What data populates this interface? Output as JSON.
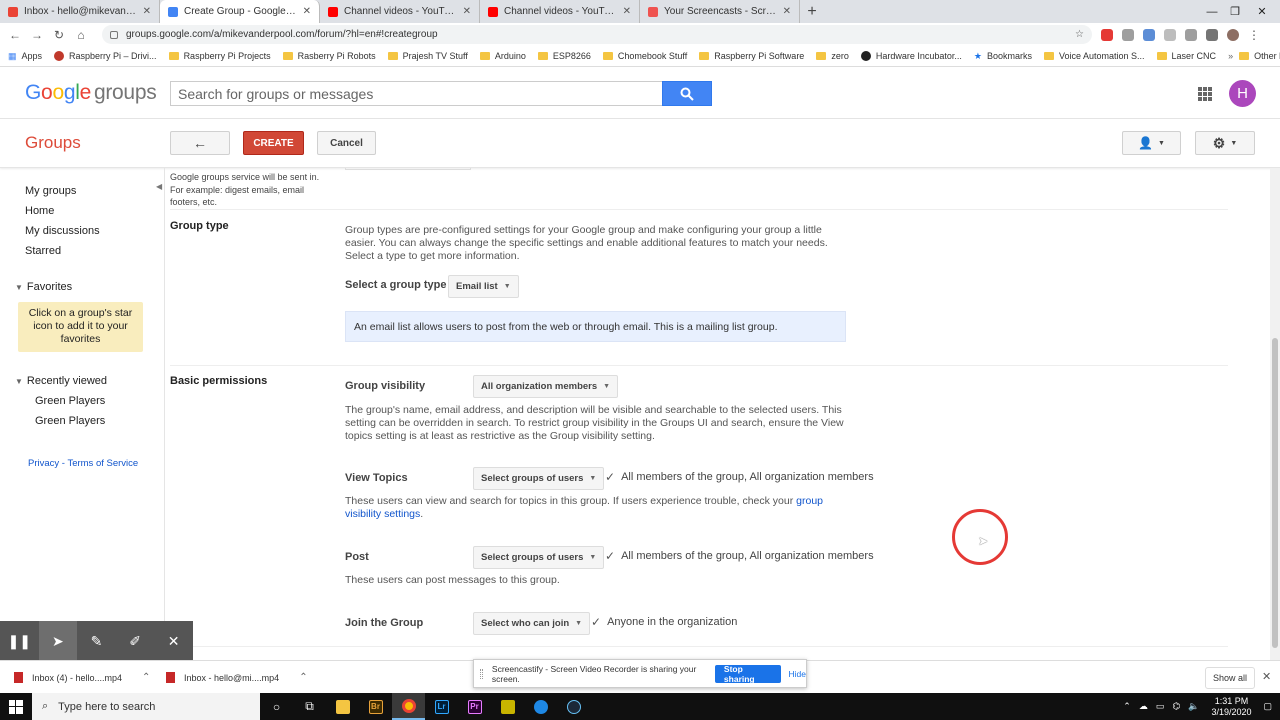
{
  "browser": {
    "tabs": [
      {
        "title": "Inbox - hello@mikevanderpool.c",
        "favicon_color": "#ea4335"
      },
      {
        "title": "Create Group - Google Groups",
        "favicon_color": "#4285f4",
        "active": true
      },
      {
        "title": "Channel videos - YouTube Studio",
        "favicon_color": "#ff0000"
      },
      {
        "title": "Channel videos - YouTube Studio",
        "favicon_color": "#ff0000"
      },
      {
        "title": "Your Screencasts - Screencastify",
        "favicon_color": "#ef5350"
      }
    ],
    "url": "groups.google.com/a/mikevanderpool.com/forum/?hl=en#!creategroup",
    "bookmarks": [
      "Apps",
      "Raspberry Pi – Drivi...",
      "Raspberry Pi Projects",
      "Rasberry Pi Robots",
      "Prajesh TV Stuff",
      "Arduino",
      "ESP8266",
      "Chomebook Stuff",
      "Raspberry Pi Software",
      "zero",
      "Hardware Incubator...",
      "Bookmarks",
      "Voice Automation S...",
      "Laser CNC"
    ],
    "other_bookmarks": "Other bookmarks"
  },
  "header": {
    "logo_google": [
      "G",
      "o",
      "o",
      "g",
      "l",
      "e"
    ],
    "logo_groups": "groups",
    "search_placeholder": "Search for groups or messages",
    "avatar_letter": "H",
    "avatar_color": "#ab47bc"
  },
  "actionbar": {
    "title": "Groups",
    "back_icon": "←",
    "create_label": "CREATE",
    "cancel_label": "Cancel"
  },
  "sidebar": {
    "items": [
      "My groups",
      "Home",
      "My discussions",
      "Starred"
    ],
    "favorites_label": "Favorites",
    "favorites_hint": "Click on a group's star icon to add it to your favorites",
    "recently_viewed_label": "Recently viewed",
    "recent": [
      "Green Players",
      "Green Players"
    ],
    "privacy": "Privacy",
    "dash": " - ",
    "terms": "Terms of Service"
  },
  "main": {
    "top_note": "Google groups service will be sent in. For example: digest emails, email footers, etc.",
    "group_type": {
      "label": "Group type",
      "description": "Group types are pre-configured settings for your Google group and make configuring your group a little easier. You can always change the specific settings and enable additional features to match your needs. Select a type to get more information.",
      "select_label": "Select a group type",
      "selected": "Email list",
      "info": "An email list allows users to post from the web or through email. This is a mailing list group."
    },
    "basic_permissions": {
      "label": "Basic permissions",
      "visibility_label": "Group visibility",
      "visibility_value": "All organization members",
      "visibility_desc": "The group's name, email address, and description will be visible and searchable to the selected users. This setting can be overridden in search. To restrict group visibility in the Groups UI and search, ensure the View topics setting is at least as restrictive as the Group visibility setting.",
      "view_topics_label": "View Topics",
      "view_topics_select": "Select groups of users",
      "view_topics_value": "All members of the group, All organization members",
      "view_topics_desc": "These users can view and search for topics in this group. If users experience trouble, check your",
      "view_topics_link": "group visibility settings",
      "period": ".",
      "post_label": "Post",
      "post_select": "Select groups of users",
      "post_value": "All members of the group, All organization members",
      "post_desc": "These users can post messages to this group.",
      "join_label": "Join the Group",
      "join_select": "Select who can join",
      "join_value": "Anyone in the organization"
    }
  },
  "screencastify": {
    "share_text": "Screencastify - Screen Video Recorder is sharing your screen.",
    "stop_label": "Stop sharing",
    "hide_label": "Hide"
  },
  "downloads": {
    "items": [
      "Inbox (4) - hello....mp4",
      "Inbox - hello@mi....mp4"
    ],
    "show_all": "Show all"
  },
  "taskbar": {
    "search_placeholder": "Type here to search",
    "time": "1:31 PM",
    "date": "3/19/2020"
  }
}
